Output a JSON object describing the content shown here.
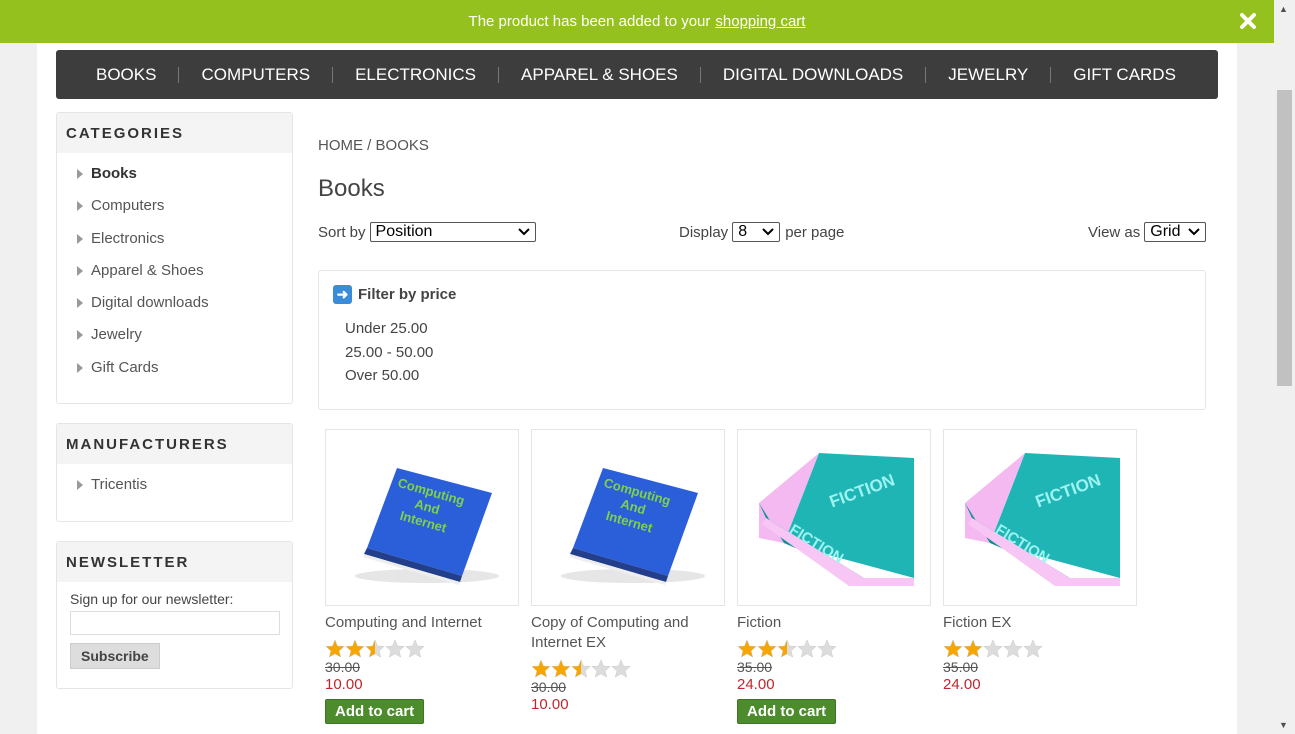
{
  "notification": {
    "text": "The product has been added to your",
    "link": "shopping cart"
  },
  "menu": [
    "BOOKS",
    "COMPUTERS",
    "ELECTRONICS",
    "APPAREL & SHOES",
    "DIGITAL DOWNLOADS",
    "JEWELRY",
    "GIFT CARDS"
  ],
  "categories": {
    "title": "CATEGORIES",
    "items": [
      "Books",
      "Computers",
      "Electronics",
      "Apparel & Shoes",
      "Digital downloads",
      "Jewelry",
      "Gift Cards"
    ],
    "active_index": 0
  },
  "manufacturers": {
    "title": "MANUFACTURERS",
    "items": [
      "Tricentis"
    ]
  },
  "newsletter": {
    "title": "NEWSLETTER",
    "label": "Sign up for our newsletter:",
    "button": "Subscribe"
  },
  "breadcrumb": {
    "home": "HOME",
    "sep": "/",
    "current": "BOOKS"
  },
  "page_title": "Books",
  "sort": {
    "label": "Sort by",
    "value": "Position"
  },
  "display": {
    "label": "Display",
    "value": "8",
    "suffix": "per page"
  },
  "view": {
    "label": "View as",
    "value": "Grid"
  },
  "filter": {
    "title": "Filter by price",
    "options": [
      "Under 25.00",
      "25.00 - 50.00",
      "Over 50.00"
    ]
  },
  "products": [
    {
      "title": "Computing and Internet",
      "rating": 2.5,
      "old_price": "30.00",
      "price": "10.00",
      "cart": "Add to cart",
      "cover": "blue",
      "cover_text": "Computing And Internet"
    },
    {
      "title": "Copy of Computing and Internet EX",
      "rating": 2.5,
      "old_price": "30.00",
      "price": "10.00",
      "cart": "",
      "cover": "blue",
      "cover_text": "Computing And Internet"
    },
    {
      "title": "Fiction",
      "rating": 2.5,
      "old_price": "35.00",
      "price": "24.00",
      "cart": "Add to cart",
      "cover": "teal",
      "cover_text": "FICTION"
    },
    {
      "title": "Fiction EX",
      "rating": 2,
      "old_price": "35.00",
      "price": "24.00",
      "cart": "",
      "cover": "teal",
      "cover_text": "FICTION"
    }
  ],
  "colors": {
    "notification": "#95c11f",
    "menu": "#3d3d3d",
    "price": "#c0272d",
    "cart_button": "#4d8c2d",
    "star": "#f7a600"
  }
}
